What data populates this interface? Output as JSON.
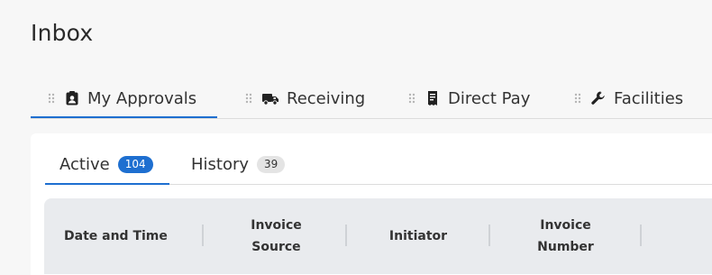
{
  "page": {
    "title": "Inbox"
  },
  "top_tabs": [
    {
      "label": "My Approvals",
      "icon": "clipboard-user-icon",
      "active": true
    },
    {
      "label": "Receiving",
      "icon": "truck-icon",
      "active": false
    },
    {
      "label": "Direct Pay",
      "icon": "receipt-icon",
      "active": false
    },
    {
      "label": "Facilities",
      "icon": "wrench-icon",
      "active": false
    }
  ],
  "sub_tabs": [
    {
      "label": "Active",
      "count": "104",
      "active": true
    },
    {
      "label": "History",
      "count": "39",
      "active": false
    }
  ],
  "table": {
    "columns": [
      {
        "line1": "Date and Time",
        "line2": ""
      },
      {
        "line1": "Invoice",
        "line2": "Source"
      },
      {
        "line1": "Initiator",
        "line2": ""
      },
      {
        "line1": "Invoice",
        "line2": "Number"
      }
    ]
  },
  "colors": {
    "accent": "#1e6fd0",
    "header_bg": "#e9ebee"
  }
}
